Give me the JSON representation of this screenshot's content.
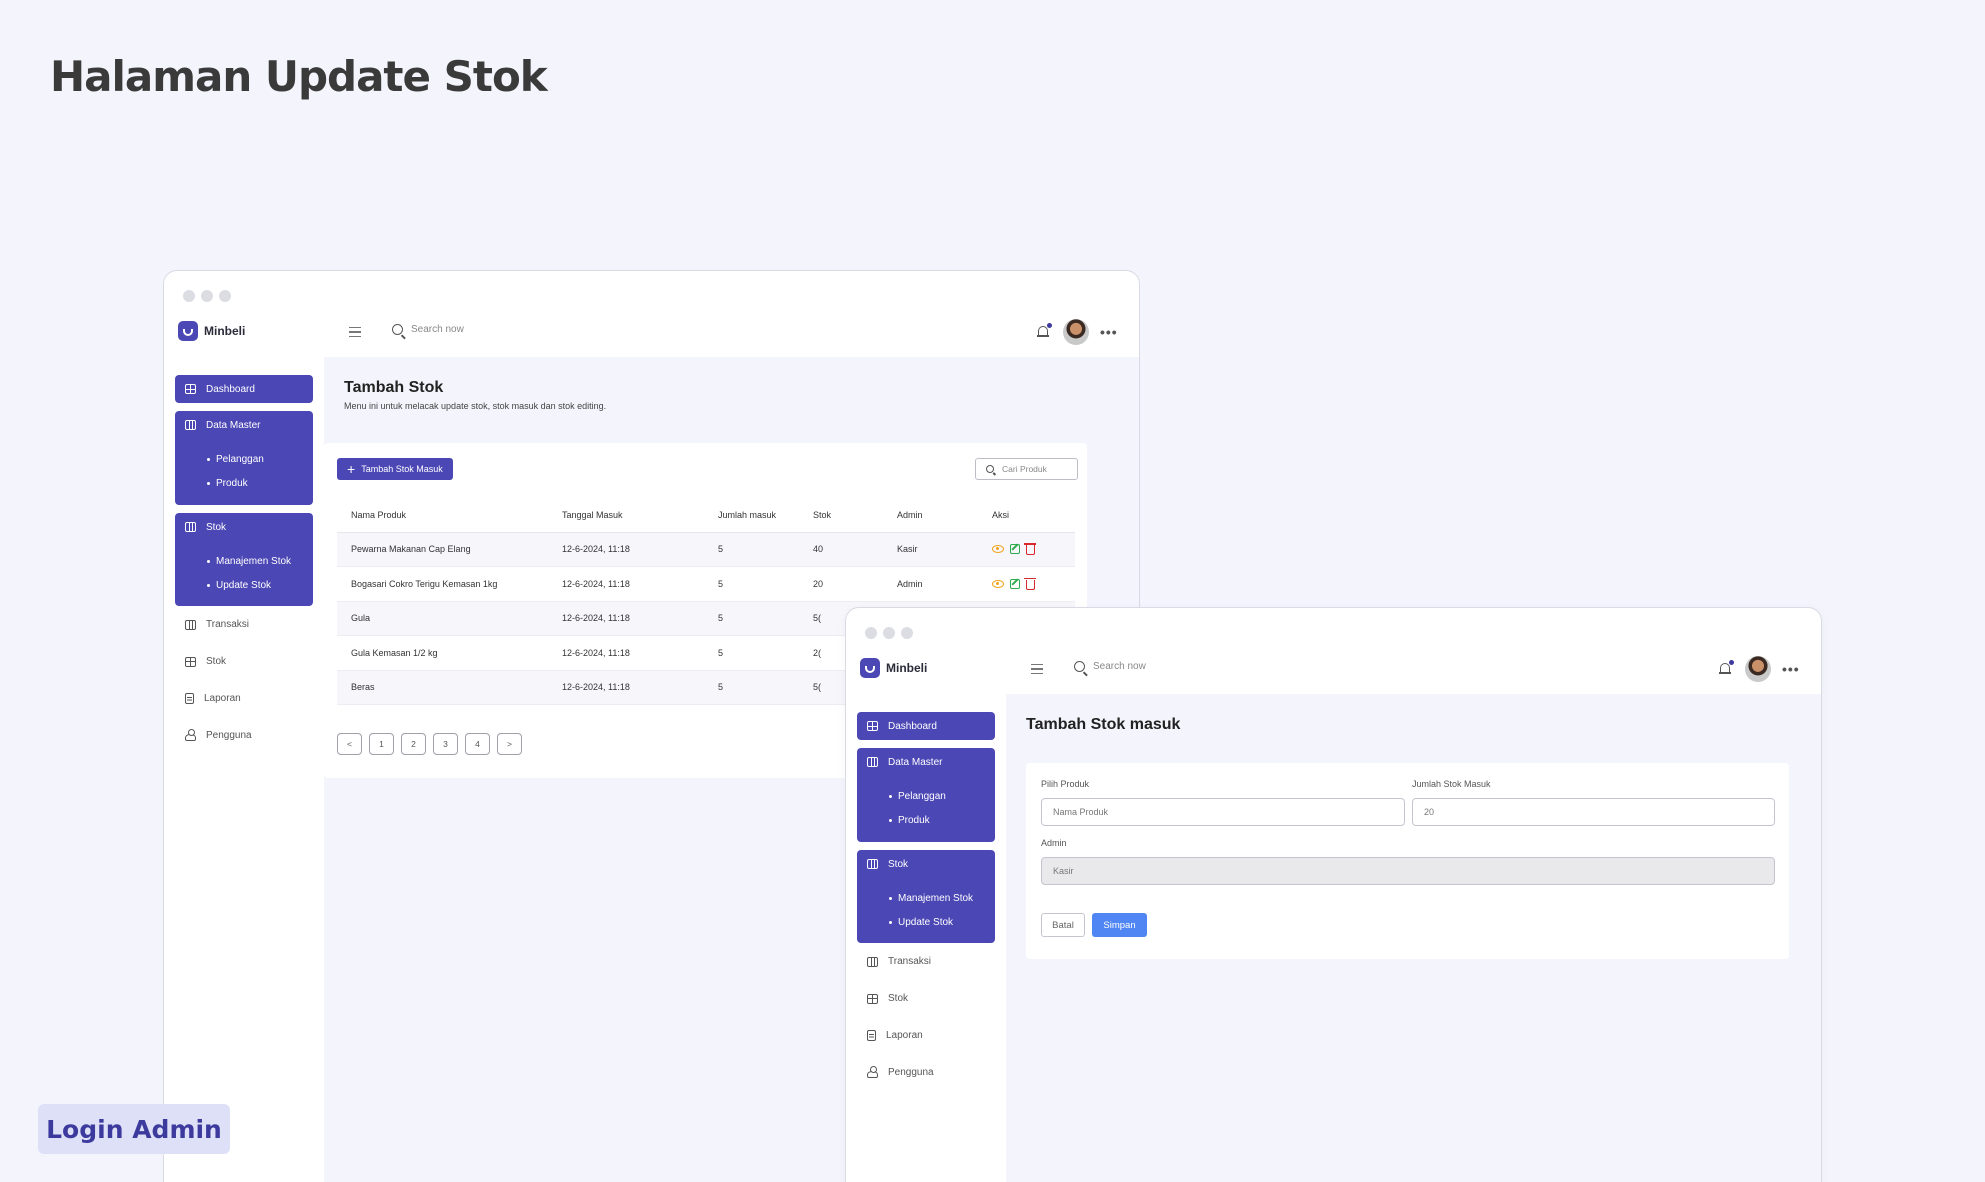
{
  "page": {
    "title": "Halaman Update Stok",
    "footer_badge": "Login Admin"
  },
  "app": {
    "brand": "Minbeli",
    "search_placeholder": "Search now"
  },
  "sidebar": {
    "dashboard": "Dashboard",
    "data_master": "Data Master",
    "data_master_items": [
      "Pelanggan",
      "Produk"
    ],
    "stok": "Stok",
    "stok_items": [
      "Manajemen Stok",
      "Update Stok"
    ],
    "plain_items": [
      "Transaksi",
      "Stok",
      "Laporan",
      "Pengguna"
    ]
  },
  "list_view": {
    "title": "Tambah Stok",
    "subtitle": "Menu ini untuk melacak update stok, stok masuk dan stok editing.",
    "add_button": "Tambah Stok Masuk",
    "search_placeholder": "Cari Produk",
    "columns": [
      "Nama Produk",
      "Tanggal Masuk",
      "Jumlah masuk",
      "Stok",
      "Admin",
      "Aksi"
    ],
    "rows": [
      {
        "product": "Pewarna Makanan Cap Elang",
        "date": "12-6-2024, 11:18",
        "qty": "5",
        "stock": "40",
        "admin": "Kasir"
      },
      {
        "product": "Bogasari Cokro Terigu Kemasan 1kg",
        "date": "12-6-2024, 11:18",
        "qty": "5",
        "stock": "20",
        "admin": "Admin"
      },
      {
        "product": "Gula",
        "date": "12-6-2024, 11:18",
        "qty": "5",
        "stock": "5(",
        "admin": ""
      },
      {
        "product": "Gula Kemasan 1/2 kg",
        "date": "12-6-2024, 11:18",
        "qty": "5",
        "stock": "2(",
        "admin": ""
      },
      {
        "product": "Beras",
        "date": "12-6-2024, 11:18",
        "qty": "5",
        "stock": "5(",
        "admin": ""
      }
    ],
    "pagination": [
      "<",
      "1",
      "2",
      "3",
      "4",
      ">"
    ]
  },
  "form_view": {
    "title": "Tambah Stok masuk",
    "product_label": "Pilih Produk",
    "product_placeholder": "Nama Produk",
    "qty_label": "Jumlah Stok Masuk",
    "qty_value": "20",
    "admin_label": "Admin",
    "admin_value": "Kasir",
    "cancel_button": "Batal",
    "save_button": "Simpan"
  },
  "colors": {
    "accent": "#4b47b5",
    "background": "#f4f5fc",
    "save_blue": "#4f86f3",
    "view_action": "#f0a51e",
    "edit_action": "#2eab4d",
    "delete_action": "#d9272e"
  }
}
